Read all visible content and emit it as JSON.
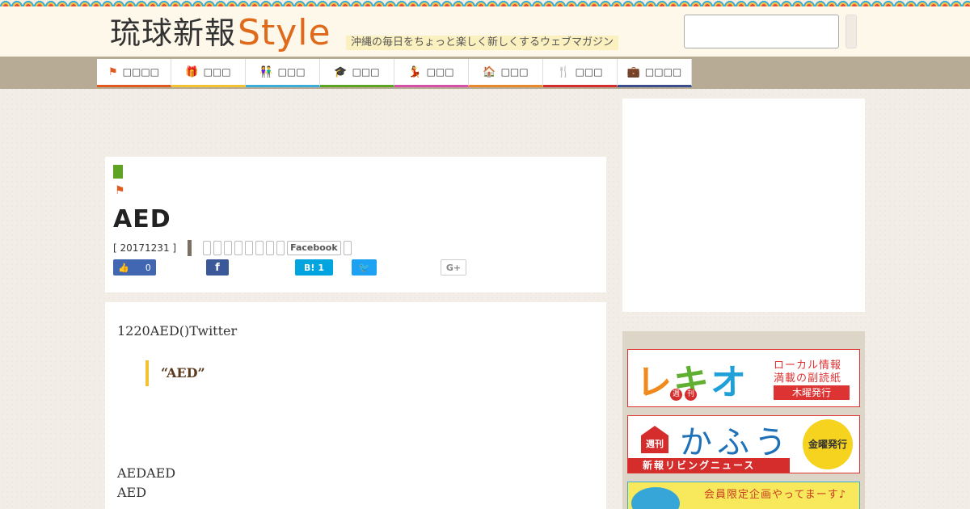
{
  "header": {
    "logo_jp": "琉球新報",
    "logo_style": "Style",
    "tagline": "沖縄の毎日をちょっと楽しく新しくするウェブマガジン",
    "search_placeholder": ""
  },
  "nav": {
    "items": [
      {
        "label": "□□□□",
        "icon": "flag-icon",
        "color": "#e05a20"
      },
      {
        "label": "□□□",
        "icon": "gift-icon",
        "color": "#f2c230"
      },
      {
        "label": "□□□",
        "icon": "couple-icon",
        "color": "#3aaed8"
      },
      {
        "label": "□□□",
        "icon": "graduation-cap-icon",
        "color": "#5fa322"
      },
      {
        "label": "□□□",
        "icon": "dancer-icon",
        "color": "#d84fa8"
      },
      {
        "label": "□□□",
        "icon": "house-icon",
        "color": "#e88a2c"
      },
      {
        "label": "□□□",
        "icon": "fork-knife-icon",
        "color": "#d52c2c"
      },
      {
        "label": "□□□□",
        "icon": "briefcase-icon",
        "color": "#3a4e8c"
      }
    ]
  },
  "article": {
    "category_color": "#5fa322",
    "title": "AED",
    "date": "[ 20171231 ]",
    "facebook_tag": "Facebook",
    "share": {
      "like_count": "0",
      "hatena_label": "B!",
      "hatena_count": "1",
      "gplus_label": "G+"
    },
    "intro": "1220AED()Twitter",
    "quote": "“AED”",
    "body_lines": [
      "AEDAED",
      "AED"
    ]
  },
  "sidebar": {
    "lekio": {
      "logo": "レキオ",
      "shu": "週",
      "kan": "刊",
      "desc1": "ローカル情報",
      "desc2": "満載の副読紙",
      "day": "木曜発行"
    },
    "kafu": {
      "badge": "週刊",
      "title": "かふう",
      "sub": "新報リビングニュース",
      "day": "金曜発行"
    },
    "member": {
      "text": "会員限定企画やってまーす♪"
    }
  }
}
